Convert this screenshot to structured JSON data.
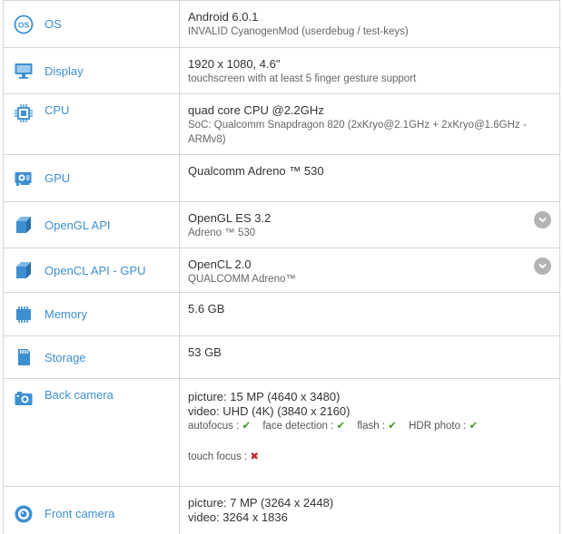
{
  "colors": {
    "accent": "#3d8fd1",
    "check": "#3e9a1e",
    "cross": "#c8202a",
    "border": "#d6d6d6"
  },
  "rows": [
    {
      "icon": "os-icon",
      "label": "OS",
      "main": "Android 6.0.1",
      "sub": "INVALID CyanogenMod (userdebug / test-keys)"
    },
    {
      "icon": "display-icon",
      "label": "Display",
      "main": "1920 x 1080, 4.6\"",
      "sub": "touchscreen with at least 5 finger gesture support"
    },
    {
      "icon": "cpu-icon",
      "label": "CPU",
      "main": "quad core CPU @2.2GHz",
      "sub": "SoC: Qualcomm Snapdragon 820 (2xKryo@2.1GHz + 2xKryo@1.6GHz - ARMv8)"
    },
    {
      "icon": "gpu-icon",
      "label": "GPU",
      "main": "Qualcomm Adreno ™ 530"
    },
    {
      "icon": "opengl-icon",
      "label": "OpenGL API",
      "main": "OpenGL ES 3.2",
      "sub": "Adreno ™ 530",
      "expandable": true
    },
    {
      "icon": "opencl-icon",
      "label": "OpenCL API - GPU",
      "main": "OpenCL 2.0",
      "sub": "QUALCOMM Adreno™",
      "expandable": true
    },
    {
      "icon": "memory-icon",
      "label": "Memory",
      "main": "5.6 GB"
    },
    {
      "icon": "storage-icon",
      "label": "Storage",
      "main": "53 GB"
    },
    {
      "icon": "camera-icon",
      "label": "Back camera",
      "picture": "picture: 15 MP (4640 x 3480)",
      "video": "video: UHD (4K) (3840 x 2160)",
      "features": [
        {
          "name": "autofocus :",
          "ok": true
        },
        {
          "name": "face detection :",
          "ok": true
        },
        {
          "name": "flash :",
          "ok": true
        },
        {
          "name": "HDR photo :",
          "ok": true
        }
      ],
      "features2": [
        {
          "name": "touch focus :",
          "ok": false
        }
      ]
    },
    {
      "icon": "front-camera-icon",
      "label": "Front camera",
      "picture": "picture: 7 MP (3264 x 2448)",
      "video": "video: 3264 x 1836"
    }
  ]
}
